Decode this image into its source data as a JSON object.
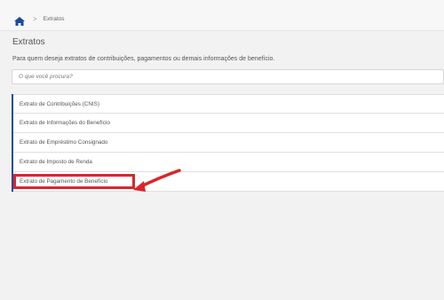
{
  "breadcrumb": {
    "current": "Extratos",
    "separator": ">"
  },
  "page": {
    "title": "Extratos",
    "subtitle": "Para quem deseja extratos de contribuições, pagamentos ou demais informações de benefício."
  },
  "search": {
    "placeholder": "O que você procura?"
  },
  "items": [
    {
      "label": "Extrato de Contribuições (CNIS)"
    },
    {
      "label": "Extrato de Informações do Benefício"
    },
    {
      "label": "Extrato de Empréstimo Consignado"
    },
    {
      "label": "Extrato de Imposto de Renda"
    },
    {
      "label": "Extrato de Pagamento de Benefício"
    }
  ],
  "colors": {
    "accent": "#1a4a9c",
    "annotation": "#d9262b"
  },
  "icons": {
    "home": "home-icon",
    "annotation": "red-arrow-annotation"
  }
}
